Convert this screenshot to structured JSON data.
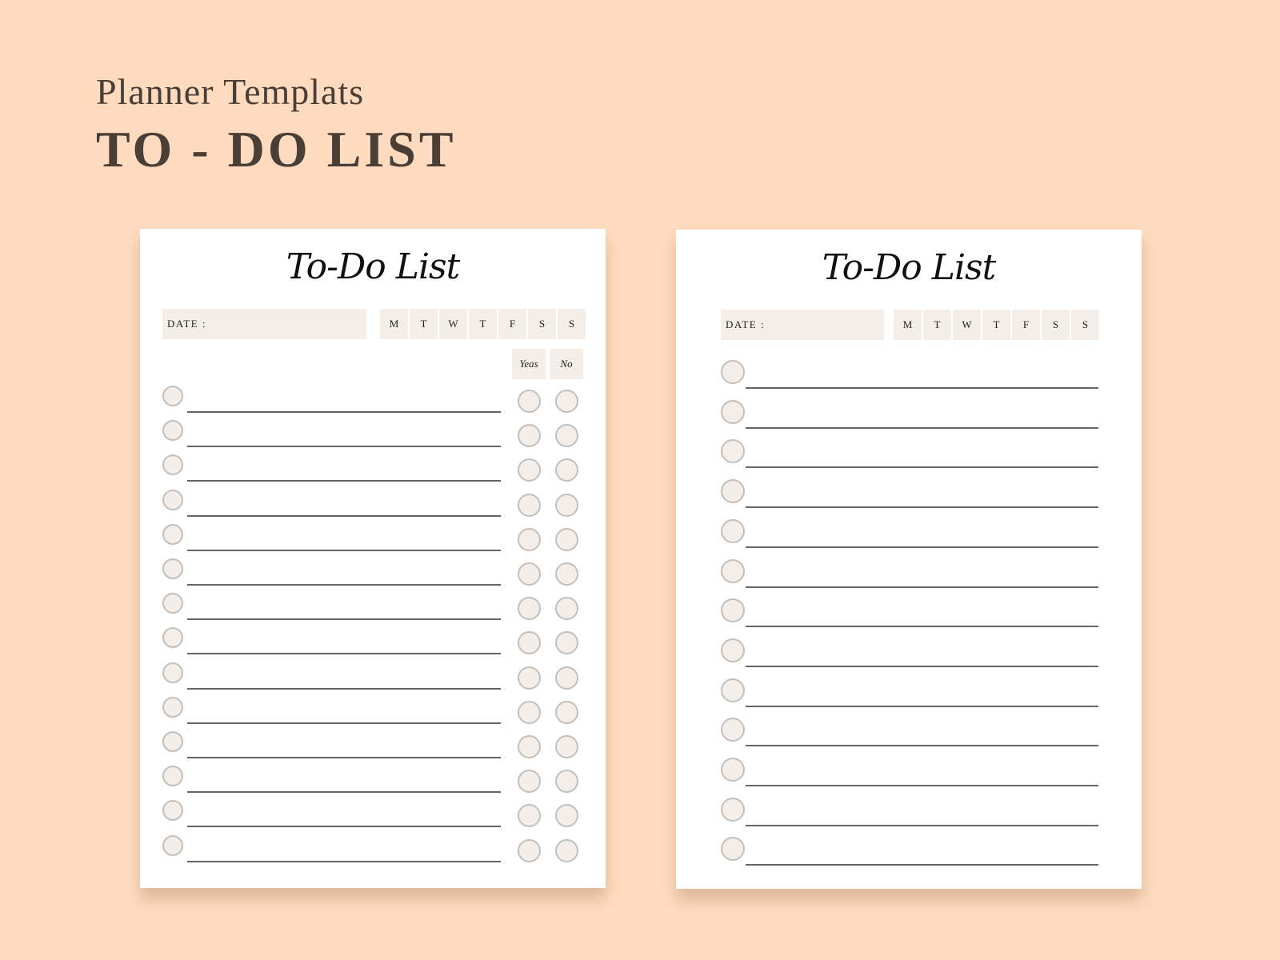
{
  "header": {
    "subtitle": "Planner Templats",
    "title": "TO - DO LIST"
  },
  "cards": [
    {
      "title": "To-Do List",
      "date_label": "DATE :",
      "days": [
        "M",
        "T",
        "W",
        "T",
        "F",
        "S",
        "S"
      ],
      "yes_label": "Yeas",
      "no_label": "No",
      "row_count": 14,
      "has_yes_no": true
    },
    {
      "title": "To-Do List",
      "date_label": "DATE :",
      "days": [
        "M",
        "T",
        "W",
        "T",
        "F",
        "S",
        "S"
      ],
      "row_count": 13,
      "has_yes_no": false
    }
  ],
  "colors": {
    "background": "#fedbbf",
    "cell": "#f4ede8",
    "heading": "#4a3f36"
  }
}
